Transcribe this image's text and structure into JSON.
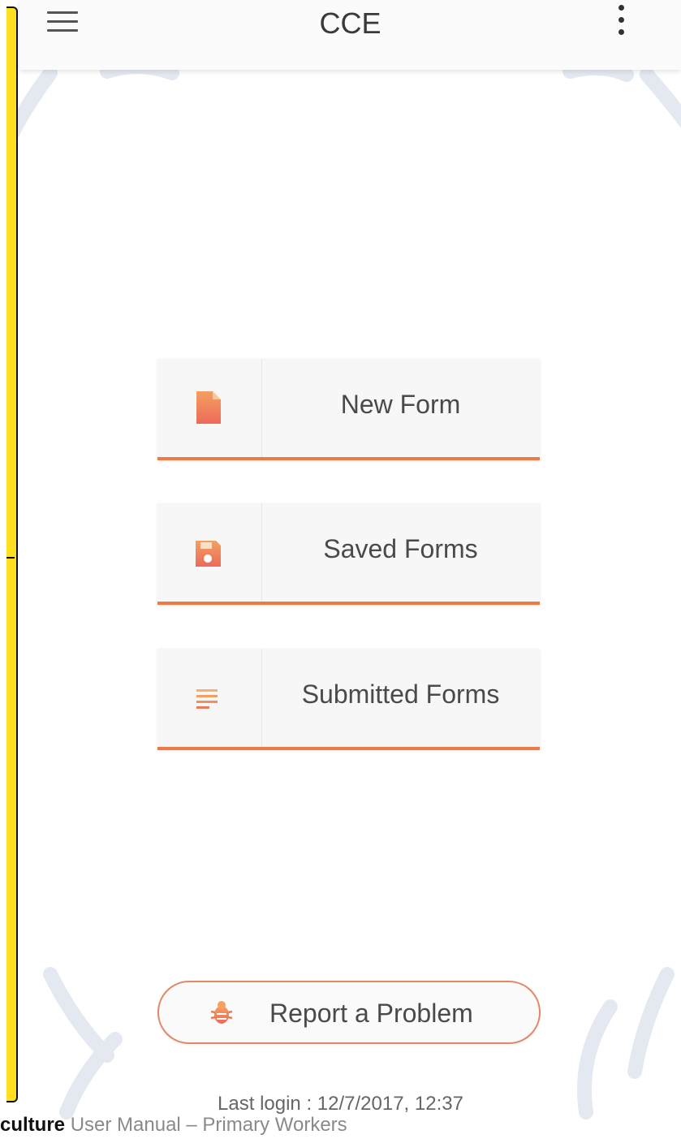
{
  "app_bar": {
    "title": "CCE",
    "menu_icon": "hamburger-menu-icon",
    "overflow_icon": "more-vert-icon"
  },
  "menu": {
    "items": [
      {
        "label": "New Form",
        "icon": "document-icon"
      },
      {
        "label": "Saved Forms",
        "icon": "save-icon"
      },
      {
        "label": "Submitted Forms",
        "icon": "list-lines-icon"
      }
    ]
  },
  "report": {
    "label": "Report a Problem",
    "icon": "bug-icon"
  },
  "last_login": {
    "label": "Last login :",
    "value": "12/7/2017, 12:37"
  },
  "footer": {
    "bold_text": "culture",
    "text": "User Manual – Primary Workers"
  },
  "colors": {
    "accent": "#ee7a43",
    "icon_gradient_top": "#f4a060",
    "icon_gradient_bottom": "#ec6a5a",
    "bracket": "#ffdf1f"
  }
}
